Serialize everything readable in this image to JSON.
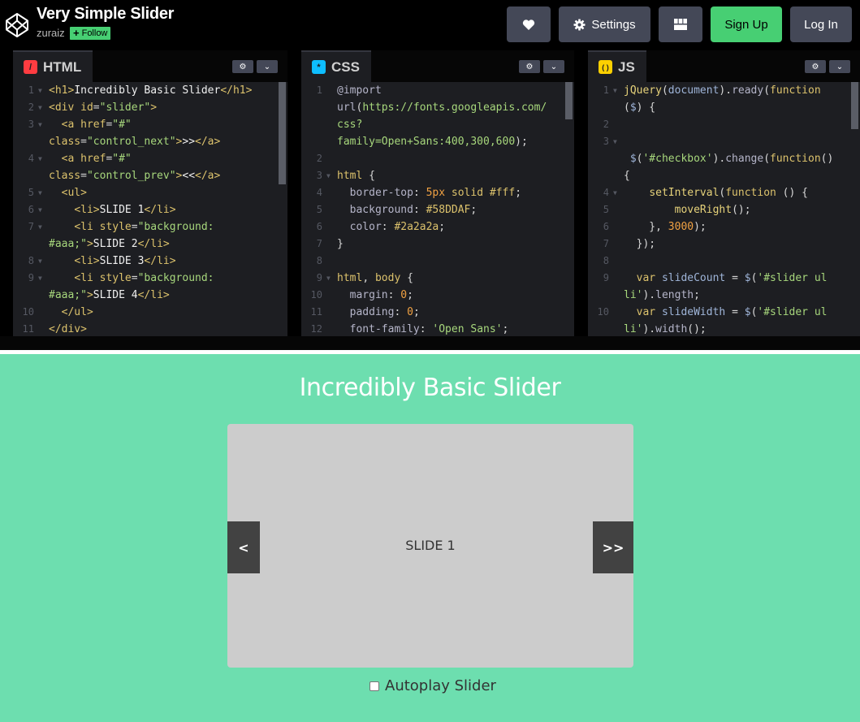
{
  "header": {
    "title": "Very Simple Slider",
    "author": "zuraiz",
    "follow_label": "Follow",
    "settings_label": "Settings",
    "signup_label": "Sign Up",
    "login_label": "Log In",
    "heart_icon": "heart-icon",
    "settings_icon": "gear-icon",
    "layout_icon": "layout-grid-icon",
    "accent_color": "#47cf73"
  },
  "editors": {
    "html": {
      "label": "HTML",
      "badge": "/",
      "badge_color": "#ff3c41",
      "lines": [
        {
          "n": "1",
          "fold": true,
          "html": "<span class=\"t-tag\">&lt;h1&gt;</span><span class=\"t-wht\">Incredibly Basic Slider</span><span class=\"t-tag\">&lt;/h1&gt;</span>"
        },
        {
          "n": "2",
          "fold": true,
          "html": "<span class=\"t-tag\">&lt;div</span> <span class=\"t-attr\">id</span>=<span class=\"t-str\">\"slider\"</span><span class=\"t-tag\">&gt;</span>"
        },
        {
          "n": "3",
          "fold": true,
          "html": "  <span class=\"t-tag\">&lt;a</span> <span class=\"t-attr\">href</span>=<span class=\"t-str\">\"#\"</span>"
        },
        {
          "n": "",
          "fold": false,
          "html": "<span class=\"t-attr\">class</span>=<span class=\"t-str\">\"control_next\"</span><span class=\"t-tag\">&gt;</span><span class=\"t-wht\">&gt;&gt;</span><span class=\"t-tag\">&lt;/a&gt;</span>"
        },
        {
          "n": "4",
          "fold": true,
          "html": "  <span class=\"t-tag\">&lt;a</span> <span class=\"t-attr\">href</span>=<span class=\"t-str\">\"#\"</span>"
        },
        {
          "n": "",
          "fold": false,
          "html": "<span class=\"t-attr\">class</span>=<span class=\"t-str\">\"control_prev\"</span><span class=\"t-tag\">&gt;</span><span class=\"t-wht\">&lt;&lt;</span><span class=\"t-tag\">&lt;/a&gt;</span>"
        },
        {
          "n": "5",
          "fold": true,
          "html": "  <span class=\"t-tag\">&lt;ul&gt;</span>"
        },
        {
          "n": "6",
          "fold": true,
          "html": "    <span class=\"t-tag\">&lt;li&gt;</span><span class=\"t-wht\">SLIDE 1</span><span class=\"t-tag\">&lt;/li&gt;</span>"
        },
        {
          "n": "7",
          "fold": true,
          "html": "    <span class=\"t-tag\">&lt;li</span> <span class=\"t-attr\">style</span>=<span class=\"t-str\">\"background:</span>"
        },
        {
          "n": "",
          "fold": false,
          "html": "<span class=\"t-str\">#aaa;\"</span><span class=\"t-tag\">&gt;</span><span class=\"t-wht\">SLIDE 2</span><span class=\"t-tag\">&lt;/li&gt;</span>"
        },
        {
          "n": "8",
          "fold": true,
          "html": "    <span class=\"t-tag\">&lt;li&gt;</span><span class=\"t-wht\">SLIDE 3</span><span class=\"t-tag\">&lt;/li&gt;</span>"
        },
        {
          "n": "9",
          "fold": true,
          "html": "    <span class=\"t-tag\">&lt;li</span> <span class=\"t-attr\">style</span>=<span class=\"t-str\">\"background:</span>"
        },
        {
          "n": "",
          "fold": false,
          "html": "<span class=\"t-str\">#aaa;\"</span><span class=\"t-tag\">&gt;</span><span class=\"t-wht\">SLIDE 4</span><span class=\"t-tag\">&lt;/li&gt;</span>"
        },
        {
          "n": "10",
          "fold": false,
          "html": "  <span class=\"t-tag\">&lt;/ul&gt;</span>"
        },
        {
          "n": "11",
          "fold": false,
          "html": "<span class=\"t-tag\">&lt;/div&gt;</span>"
        }
      ]
    },
    "css": {
      "label": "CSS",
      "badge": "*",
      "badge_color": "#0ebeff",
      "lines": [
        {
          "n": "1",
          "fold": false,
          "html": "<span class=\"t-prop\">@import</span>"
        },
        {
          "n": "",
          "fold": false,
          "html": "<span class=\"t-prop\">url</span>(<span class=\"t-str\">https://fonts.googleapis.com/</span>"
        },
        {
          "n": "",
          "fold": false,
          "html": "<span class=\"t-str\">css?</span>"
        },
        {
          "n": "",
          "fold": false,
          "html": "<span class=\"t-str\">family=Open+Sans:400,300,600</span>);"
        },
        {
          "n": "2",
          "fold": false,
          "html": ""
        },
        {
          "n": "3",
          "fold": true,
          "html": "<span class=\"t-kw\">html</span> {"
        },
        {
          "n": "4",
          "fold": false,
          "html": "  <span class=\"t-prop\">border-top</span>: <span class=\"t-num\">5px</span> <span class=\"t-kw\">solid</span> <span class=\"t-kw\">#fff</span>;"
        },
        {
          "n": "5",
          "fold": false,
          "html": "  <span class=\"t-prop\">background</span>: <span class=\"t-kw\">#58DDAF</span>;"
        },
        {
          "n": "6",
          "fold": false,
          "html": "  <span class=\"t-prop\">color</span>: <span class=\"t-kw\">#2a2a2a</span>;"
        },
        {
          "n": "7",
          "fold": false,
          "html": "}"
        },
        {
          "n": "8",
          "fold": false,
          "html": ""
        },
        {
          "n": "9",
          "fold": true,
          "html": "<span class=\"t-kw\">html</span>, <span class=\"t-kw\">body</span> {"
        },
        {
          "n": "10",
          "fold": false,
          "html": "  <span class=\"t-prop\">margin</span>: <span class=\"t-num\">0</span>;"
        },
        {
          "n": "11",
          "fold": false,
          "html": "  <span class=\"t-prop\">padding</span>: <span class=\"t-num\">0</span>;"
        },
        {
          "n": "12",
          "fold": false,
          "html": "  <span class=\"t-prop\">font-family</span>: <span class=\"t-str\">'Open Sans'</span>;"
        }
      ]
    },
    "js": {
      "label": "JS",
      "badge": "( )",
      "badge_color": "#fcd000",
      "lines": [
        {
          "n": "1",
          "fold": true,
          "html": "<span class=\"t-fn\">jQuery</span>(<span class=\"t-var\">document</span>).<span class=\"t-prop\">ready</span>(<span class=\"t-kw\">function</span>"
        },
        {
          "n": "",
          "fold": false,
          "html": "(<span class=\"t-var\">$</span>) {"
        },
        {
          "n": "2",
          "fold": false,
          "html": ""
        },
        {
          "n": "3",
          "fold": true,
          "html": ""
        },
        {
          "n": "",
          "fold": false,
          "html": " <span class=\"t-var\">$</span>(<span class=\"t-str\">'#checkbox'</span>).<span class=\"t-prop\">change</span>(<span class=\"t-kw\">function</span>()"
        },
        {
          "n": "",
          "fold": false,
          "html": "{"
        },
        {
          "n": "4",
          "fold": true,
          "html": "    <span class=\"t-fn\">setInterval</span>(<span class=\"t-kw\">function</span> () {"
        },
        {
          "n": "5",
          "fold": false,
          "html": "        <span class=\"t-fn\">moveRight</span>();"
        },
        {
          "n": "6",
          "fold": false,
          "html": "    }, <span class=\"t-num\">3000</span>);"
        },
        {
          "n": "7",
          "fold": false,
          "html": "  });"
        },
        {
          "n": "8",
          "fold": false,
          "html": ""
        },
        {
          "n": "9",
          "fold": false,
          "html": "  <span class=\"t-kw\">var</span> <span class=\"t-var\">slideCount</span> = <span class=\"t-var\">$</span>(<span class=\"t-str\">'#slider ul</span>"
        },
        {
          "n": "",
          "fold": false,
          "html": "<span class=\"t-str\">li'</span>).<span class=\"t-prop\">length</span>;"
        },
        {
          "n": "10",
          "fold": false,
          "html": "  <span class=\"t-kw\">var</span> <span class=\"t-var\">slideWidth</span> = <span class=\"t-var\">$</span>(<span class=\"t-str\">'#slider ul</span>"
        },
        {
          "n": "",
          "fold": false,
          "html": "<span class=\"t-str\">li'</span>).<span class=\"t-prop\">width</span>();"
        }
      ]
    }
  },
  "preview": {
    "heading": "Incredibly Basic Slider",
    "slide_text": "SLIDE 1",
    "prev_label": "<",
    "next_label": ">>",
    "autoplay_label": "Autoplay Slider",
    "autoplay_checked": false,
    "background_color": "#6ddeaf"
  }
}
